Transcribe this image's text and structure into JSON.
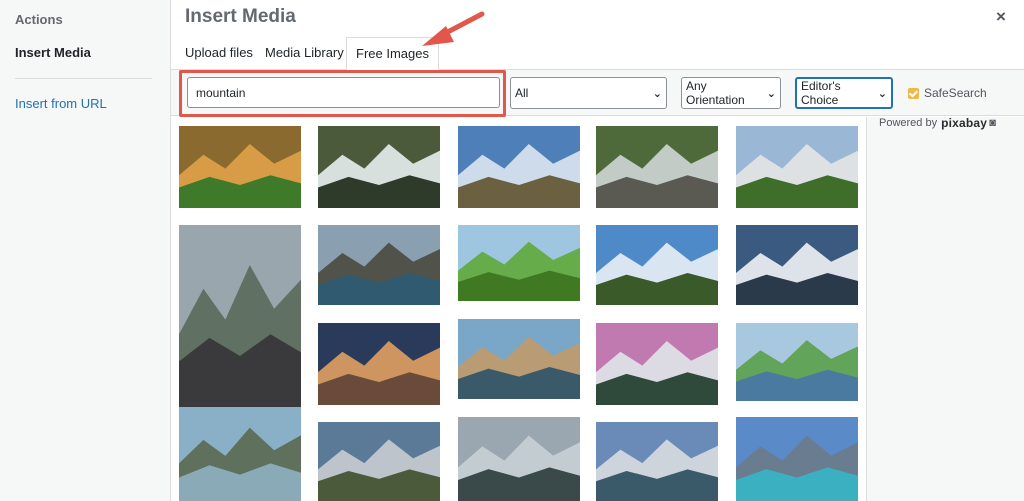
{
  "sidebar": {
    "heading": "Actions",
    "active_item": "Insert Media",
    "link": "Insert from URL"
  },
  "modal": {
    "title": "Insert Media",
    "close_glyph": "×"
  },
  "tabs": [
    {
      "label": "Upload files"
    },
    {
      "label": "Media Library"
    },
    {
      "label": "Free Images"
    }
  ],
  "filters": {
    "search_value": "mountain",
    "type_selected": "All",
    "orientation_selected": "Any Orientation",
    "order_selected": "Editor's Choice",
    "safesearch_label": "SafeSearch",
    "safesearch_checked": true
  },
  "powered": {
    "text": "Powered by",
    "brand": "pixabay"
  },
  "colors": {
    "accent": "#2271b1",
    "highlight": "#e2574c",
    "checkbox": "#f0b849"
  },
  "images": [
    {
      "alt": "autumn valley meadow",
      "palette": [
        "#8a6a2e",
        "#e0a24a",
        "#3f7a2a"
      ]
    },
    {
      "alt": "waterfall in forest",
      "palette": [
        "#4a5a3a",
        "#e8eef0",
        "#2f3b2a"
      ]
    },
    {
      "alt": "blue sky over mountains",
      "palette": [
        "#4f7fb8",
        "#dbe6ef",
        "#6b6040"
      ]
    },
    {
      "alt": "waterfall on rocks",
      "palette": [
        "#4f6a3a",
        "#cfd6d6",
        "#5a5a52"
      ]
    },
    {
      "alt": "snowy peaks green slope",
      "palette": [
        "#9bb7d6",
        "#e6e6e6",
        "#3f6d2a"
      ]
    },
    {
      "alt": "mountain road in fog",
      "palette": [
        "#9aa6ad",
        "#5a6a5a",
        "#3a3a3c"
      ]
    },
    {
      "alt": "fjord from cliff",
      "palette": [
        "#8aa0b0",
        "#4a4a40",
        "#2f5a70"
      ]
    },
    {
      "alt": "green rice terraces",
      "palette": [
        "#9fc6e0",
        "#5fa83a",
        "#3f7a22"
      ]
    },
    {
      "alt": "alpine glacier peaks",
      "palette": [
        "#4f8ac8",
        "#e8eef4",
        "#3a5a2a"
      ]
    },
    {
      "alt": "snow covered mountain",
      "palette": [
        "#3a5a80",
        "#f0f2f4",
        "#2a3a4a"
      ]
    },
    {
      "alt": "lakeside town",
      "palette": [
        "#7aa6c8",
        "#c09a6a",
        "#3a5a6a"
      ]
    },
    {
      "alt": "hiker above clouds",
      "palette": [
        "#2a3a5a",
        "#e0a060",
        "#6a4a3a"
      ]
    },
    {
      "alt": "waterfalls at dusk",
      "palette": [
        "#c07ab0",
        "#dfe6ea",
        "#2f4a3a"
      ]
    },
    {
      "alt": "green valley river",
      "palette": [
        "#a8c8e0",
        "#5aa04a",
        "#4a7aa0"
      ]
    },
    {
      "alt": "misty lake mountains",
      "palette": [
        "#8ab0c8",
        "#5a6a50",
        "#8aaab8"
      ]
    },
    {
      "alt": "cloudy lake shore",
      "palette": [
        "#9aa6b0",
        "#c8d0d4",
        "#3a4a4a"
      ]
    },
    {
      "alt": "turquoise lake peaks",
      "palette": [
        "#5a8ac8",
        "#6a7a8a",
        "#3ab0c0"
      ]
    },
    {
      "alt": "meadow with hikers",
      "palette": [
        "#5a7a98",
        "#c8ccd0",
        "#4a5a3a"
      ]
    },
    {
      "alt": "village by lake",
      "palette": [
        "#6a8ab8",
        "#d8dce0",
        "#3a5a6a"
      ]
    }
  ]
}
